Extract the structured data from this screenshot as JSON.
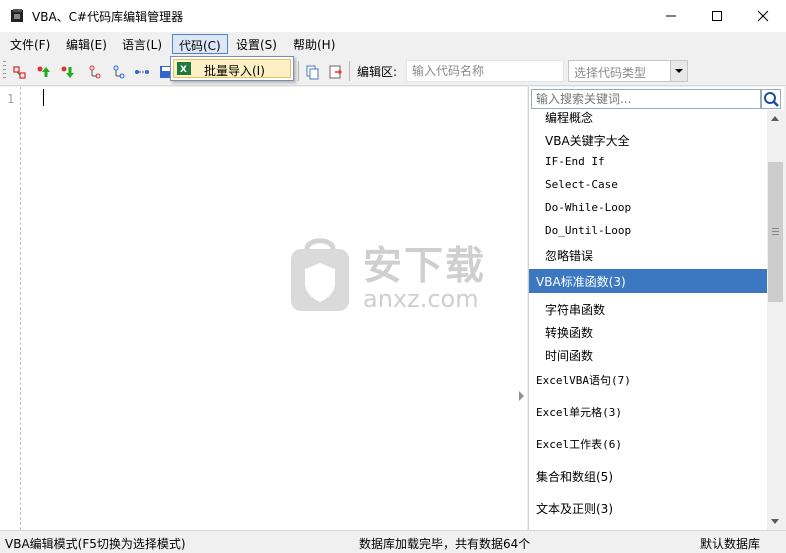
{
  "window": {
    "title": "VBA、C#代码库编辑管理器",
    "icons": {
      "app": "app-icon",
      "minimize": "minimize-icon",
      "maximize": "maximize-icon",
      "close": "close-icon"
    }
  },
  "menu": [
    {
      "label": "文件(F)"
    },
    {
      "label": "编辑(E)"
    },
    {
      "label": "语言(L)"
    },
    {
      "label": "代码(C)"
    },
    {
      "label": "设置(S)"
    },
    {
      "label": "帮助(H)"
    }
  ],
  "code_menu_dropdown": {
    "items": [
      {
        "label": "批量导入(I)",
        "icon": "excel-icon"
      }
    ]
  },
  "toolbar": {
    "edit_area_label": "编辑区:",
    "name_input": {
      "placeholder": "输入代码名称",
      "value": ""
    },
    "type_select": {
      "value": "选择代码类型"
    },
    "icons": [
      "new-code-icon",
      "move-up-icon",
      "move-down-icon",
      "tree-node-icon",
      "tree-node-add-icon",
      "link-icon",
      "save-icon",
      "copy-icon",
      "export-icon"
    ]
  },
  "editor": {
    "line_numbers": [
      "1"
    ],
    "content": ""
  },
  "watermark": {
    "text": "安下载",
    "sub": "anxz.com"
  },
  "side_panel": {
    "search": {
      "placeholder": "输入搜索关键词...",
      "value": ""
    },
    "tree": [
      {
        "label": "编程概念",
        "level": 1,
        "selected": false
      },
      {
        "label": "VBA关键字大全",
        "level": 1,
        "selected": false
      },
      {
        "label": "IF-End If",
        "level": 1,
        "selected": false
      },
      {
        "label": "Select-Case",
        "level": 1,
        "selected": false
      },
      {
        "label": "Do-While-Loop",
        "level": 1,
        "selected": false
      },
      {
        "label": "Do_Until-Loop",
        "level": 1,
        "selected": false
      },
      {
        "label": "忽略错误",
        "level": 1,
        "selected": false
      },
      {
        "label": "VBA标准函数(3)",
        "level": 0,
        "selected": true
      },
      {
        "label": "字符串函数",
        "level": 1,
        "selected": false
      },
      {
        "label": "转换函数",
        "level": 1,
        "selected": false
      },
      {
        "label": "时间函数",
        "level": 1,
        "selected": false
      },
      {
        "label": "ExcelVBA语句(7)",
        "level": 0,
        "selected": false
      },
      {
        "label": "Excel单元格(3)",
        "level": 0,
        "selected": false
      },
      {
        "label": "Excel工作表(6)",
        "level": 0,
        "selected": false
      },
      {
        "label": "集合和数组(5)",
        "level": 0,
        "selected": false
      },
      {
        "label": "文本及正则(3)",
        "level": 0,
        "selected": false
      }
    ]
  },
  "status": {
    "mode": "VBA编辑模式(F5切换为选择模式)",
    "db_status": "数据库加载完毕，共有数据64个",
    "db_name": "默认数据库"
  },
  "colors": {
    "selection": "#3c78c2",
    "menu_highlight": "#dce7f7",
    "dropdown_item": "#fdf0c4"
  }
}
